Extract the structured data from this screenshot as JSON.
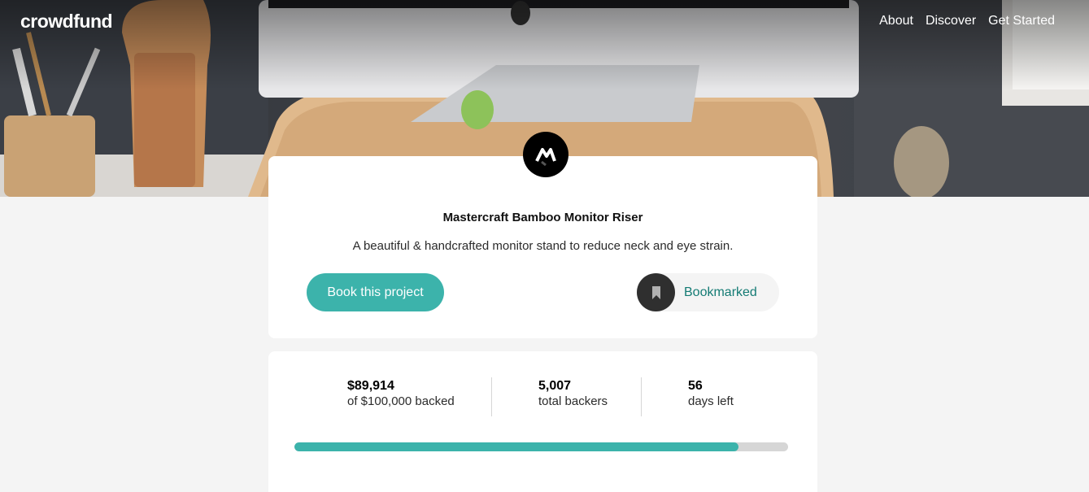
{
  "header": {
    "logo": "crowdfund",
    "nav": [
      "About",
      "Discover",
      "Get Started"
    ]
  },
  "project": {
    "logo_icon": "mastercraft-logo-icon",
    "title": "Mastercraft Bamboo Monitor Riser",
    "description": "A beautiful & handcrafted monitor stand to reduce neck and eye strain.",
    "back_button": "Book this project",
    "bookmark_label": "Bookmarked",
    "bookmark_icon": "bookmark-icon"
  },
  "stats": [
    {
      "value": "$89,914",
      "label": "of $100,000 backed"
    },
    {
      "value": "5,007",
      "label": "total backers"
    },
    {
      "value": "56",
      "label": "days left"
    }
  ],
  "progress": {
    "fraction": 0.899
  },
  "colors": {
    "accent": "#3cb3ab",
    "accent_dark": "#147b74",
    "page_bg": "#f4f4f4"
  }
}
